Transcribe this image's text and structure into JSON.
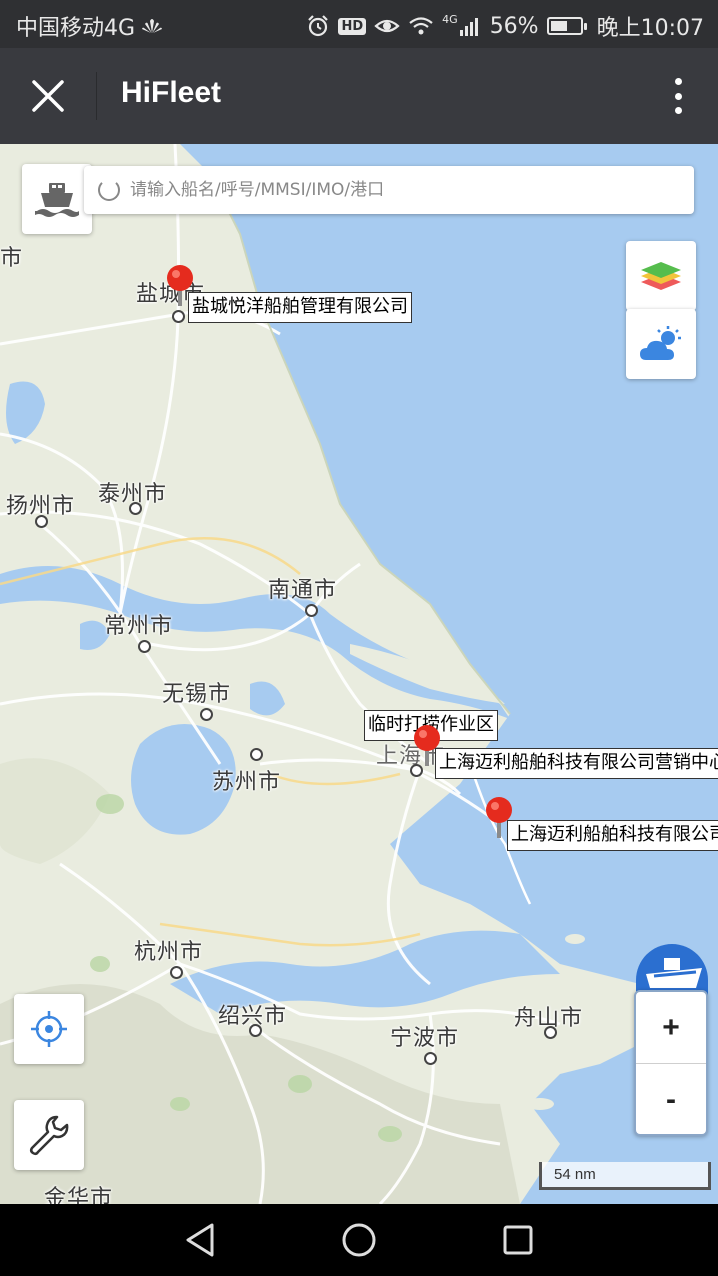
{
  "status_bar": {
    "carrier": "中国移动4G",
    "network": "4G",
    "battery": "56%",
    "battery_level": 0.56,
    "time": "晚上10:07"
  },
  "title_bar": {
    "title": "HiFleet",
    "close_icon": "close-icon",
    "more_icon": "more-vertical-icon"
  },
  "search": {
    "placeholder": "请输入船名/呼号/MMSI/IMO/港口"
  },
  "cities": [
    {
      "name": "盐城市"
    },
    {
      "name": "扬州市"
    },
    {
      "name": "泰州市"
    },
    {
      "name": "南通市"
    },
    {
      "name": "常州市"
    },
    {
      "name": "无锡市"
    },
    {
      "name": "苏州市"
    },
    {
      "name": "上海市"
    },
    {
      "name": "杭州市"
    },
    {
      "name": "绍兴市"
    },
    {
      "name": "宁波市"
    },
    {
      "name": "舟山市"
    },
    {
      "name": "金华市"
    },
    {
      "name": "市"
    }
  ],
  "markers": [
    {
      "label": "盐城悦洋船舶管理有限公司"
    },
    {
      "label": "临时打捞作业区"
    },
    {
      "label": "上海迈利船舶科技有限公司营销中心"
    },
    {
      "label": "上海迈利船舶科技有限公司"
    }
  ],
  "controls": {
    "zoom_in": "+",
    "zoom_out": "-",
    "scale": "54 nm"
  },
  "colors": {
    "sea": "#a7cbf0",
    "land": "#e9ecdf",
    "title_bar": "#393a3f",
    "status_bar": "#2f3033",
    "pin": "#e52b1e"
  }
}
